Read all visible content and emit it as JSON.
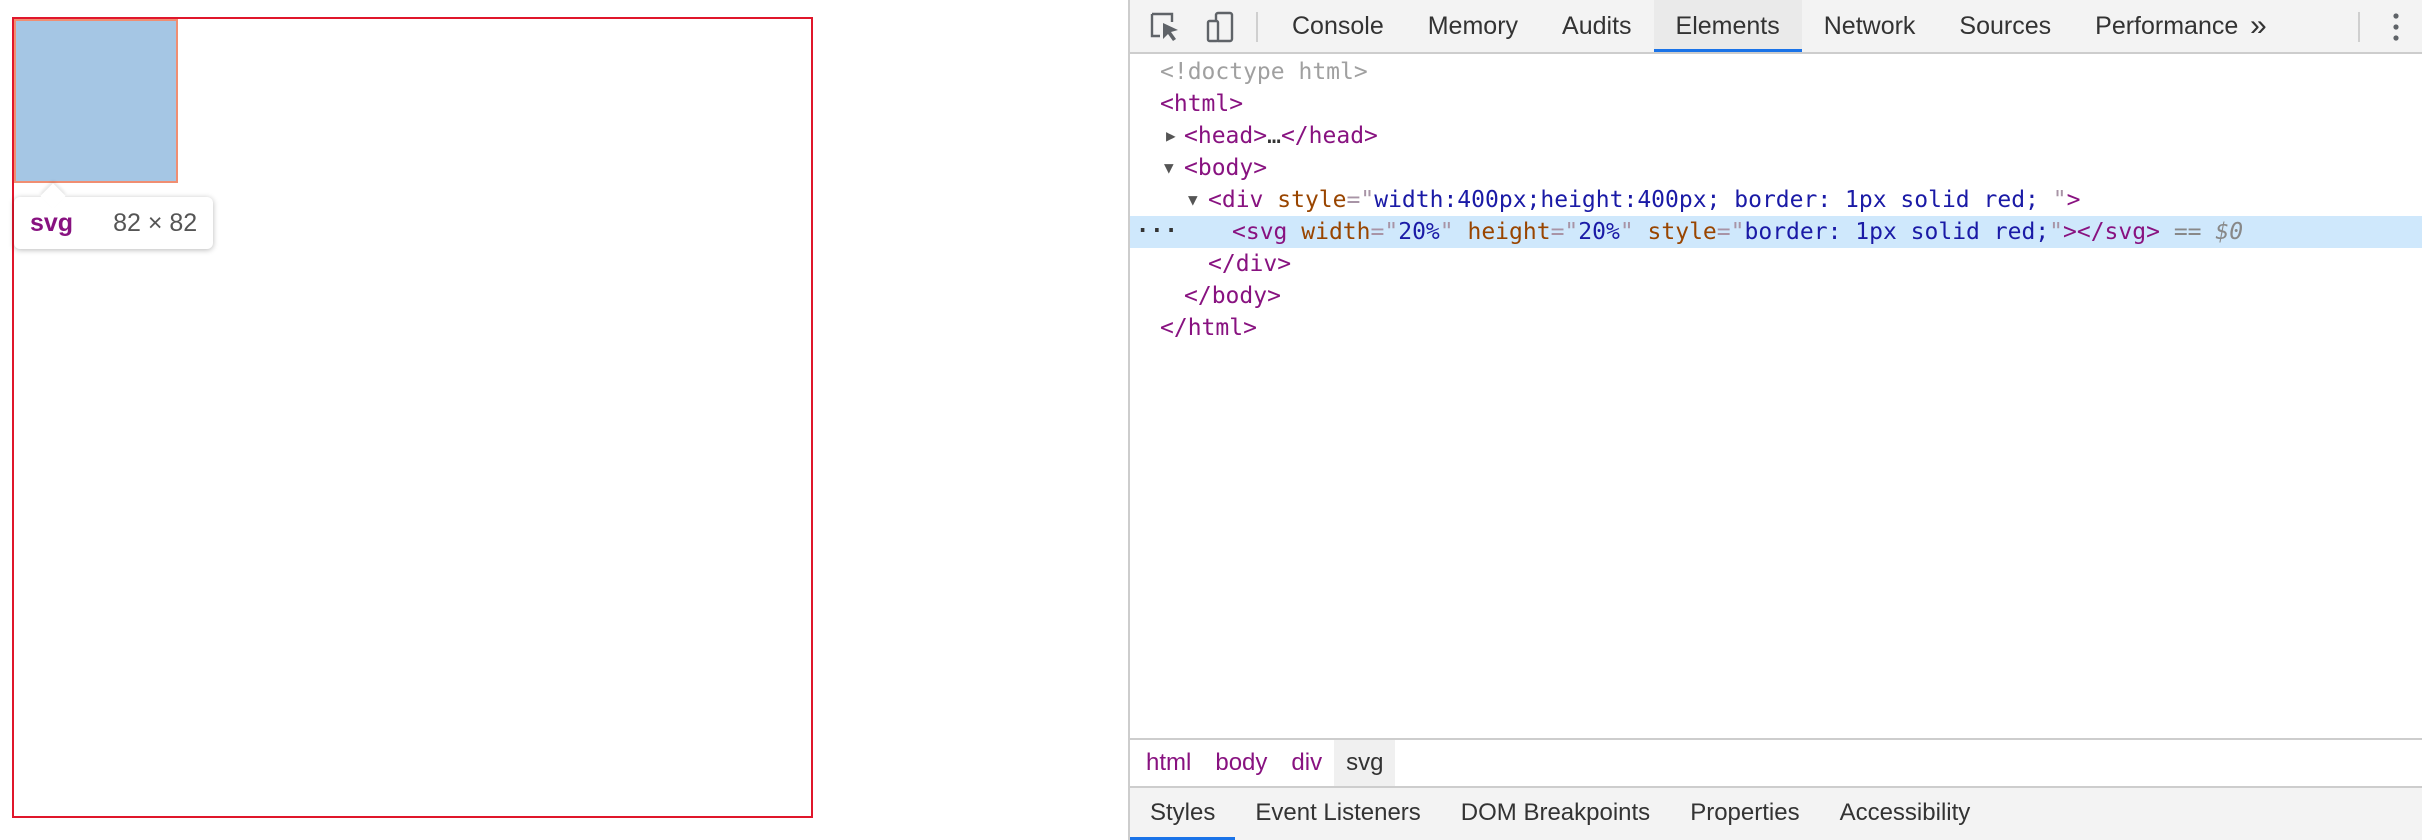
{
  "page": {
    "tooltip": {
      "tag": "svg",
      "size": "82 × 82"
    }
  },
  "devtools": {
    "tabs": [
      {
        "label": "Console"
      },
      {
        "label": "Memory"
      },
      {
        "label": "Audits"
      },
      {
        "label": "Elements"
      },
      {
        "label": "Network"
      },
      {
        "label": "Sources"
      },
      {
        "label": "Performance"
      }
    ],
    "active_tab": "Elements",
    "more_tabs_label": "»",
    "dom": {
      "doctype": "<!doctype html>",
      "html_open": "<html>",
      "head_collapsed": {
        "open": "<head>",
        "ellipsis": "…",
        "close": "</head>"
      },
      "body_open": "<body>",
      "div_tag": "div",
      "div_attr_name": "style",
      "div_attr_value": "width:400px;height:400px; border: 1px solid red; ",
      "svg_tag": "svg",
      "svg_attrs": [
        {
          "name": "width",
          "value": "20%"
        },
        {
          "name": "height",
          "value": "20%"
        },
        {
          "name": "style",
          "value": "border: 1px solid red;"
        }
      ],
      "svg_close": "</svg>",
      "selected_marker": "== $0",
      "div_close": "</div>",
      "body_close": "</body>",
      "html_close": "</html>"
    },
    "breadcrumbs": [
      "html",
      "body",
      "div",
      "svg"
    ],
    "sub_tabs": [
      "Styles",
      "Event Listeners",
      "DOM Breakpoints",
      "Properties",
      "Accessibility"
    ],
    "active_sub_tab": "Styles"
  },
  "colors": {
    "box_border": "#e0162b",
    "svg_highlight_fill": "#a5c6e4",
    "svg_highlight_border": "#f08e72",
    "selected_row": "#cfe8fc",
    "tab_underline": "#1a73e8"
  },
  "icons": {
    "inspect": "inspect-element-icon",
    "device": "device-toolbar-icon",
    "more": "more-tabs-icon",
    "kebab": "kebab-menu-icon",
    "expand": "triangle-down-icon",
    "collapse": "triangle-right-icon"
  }
}
